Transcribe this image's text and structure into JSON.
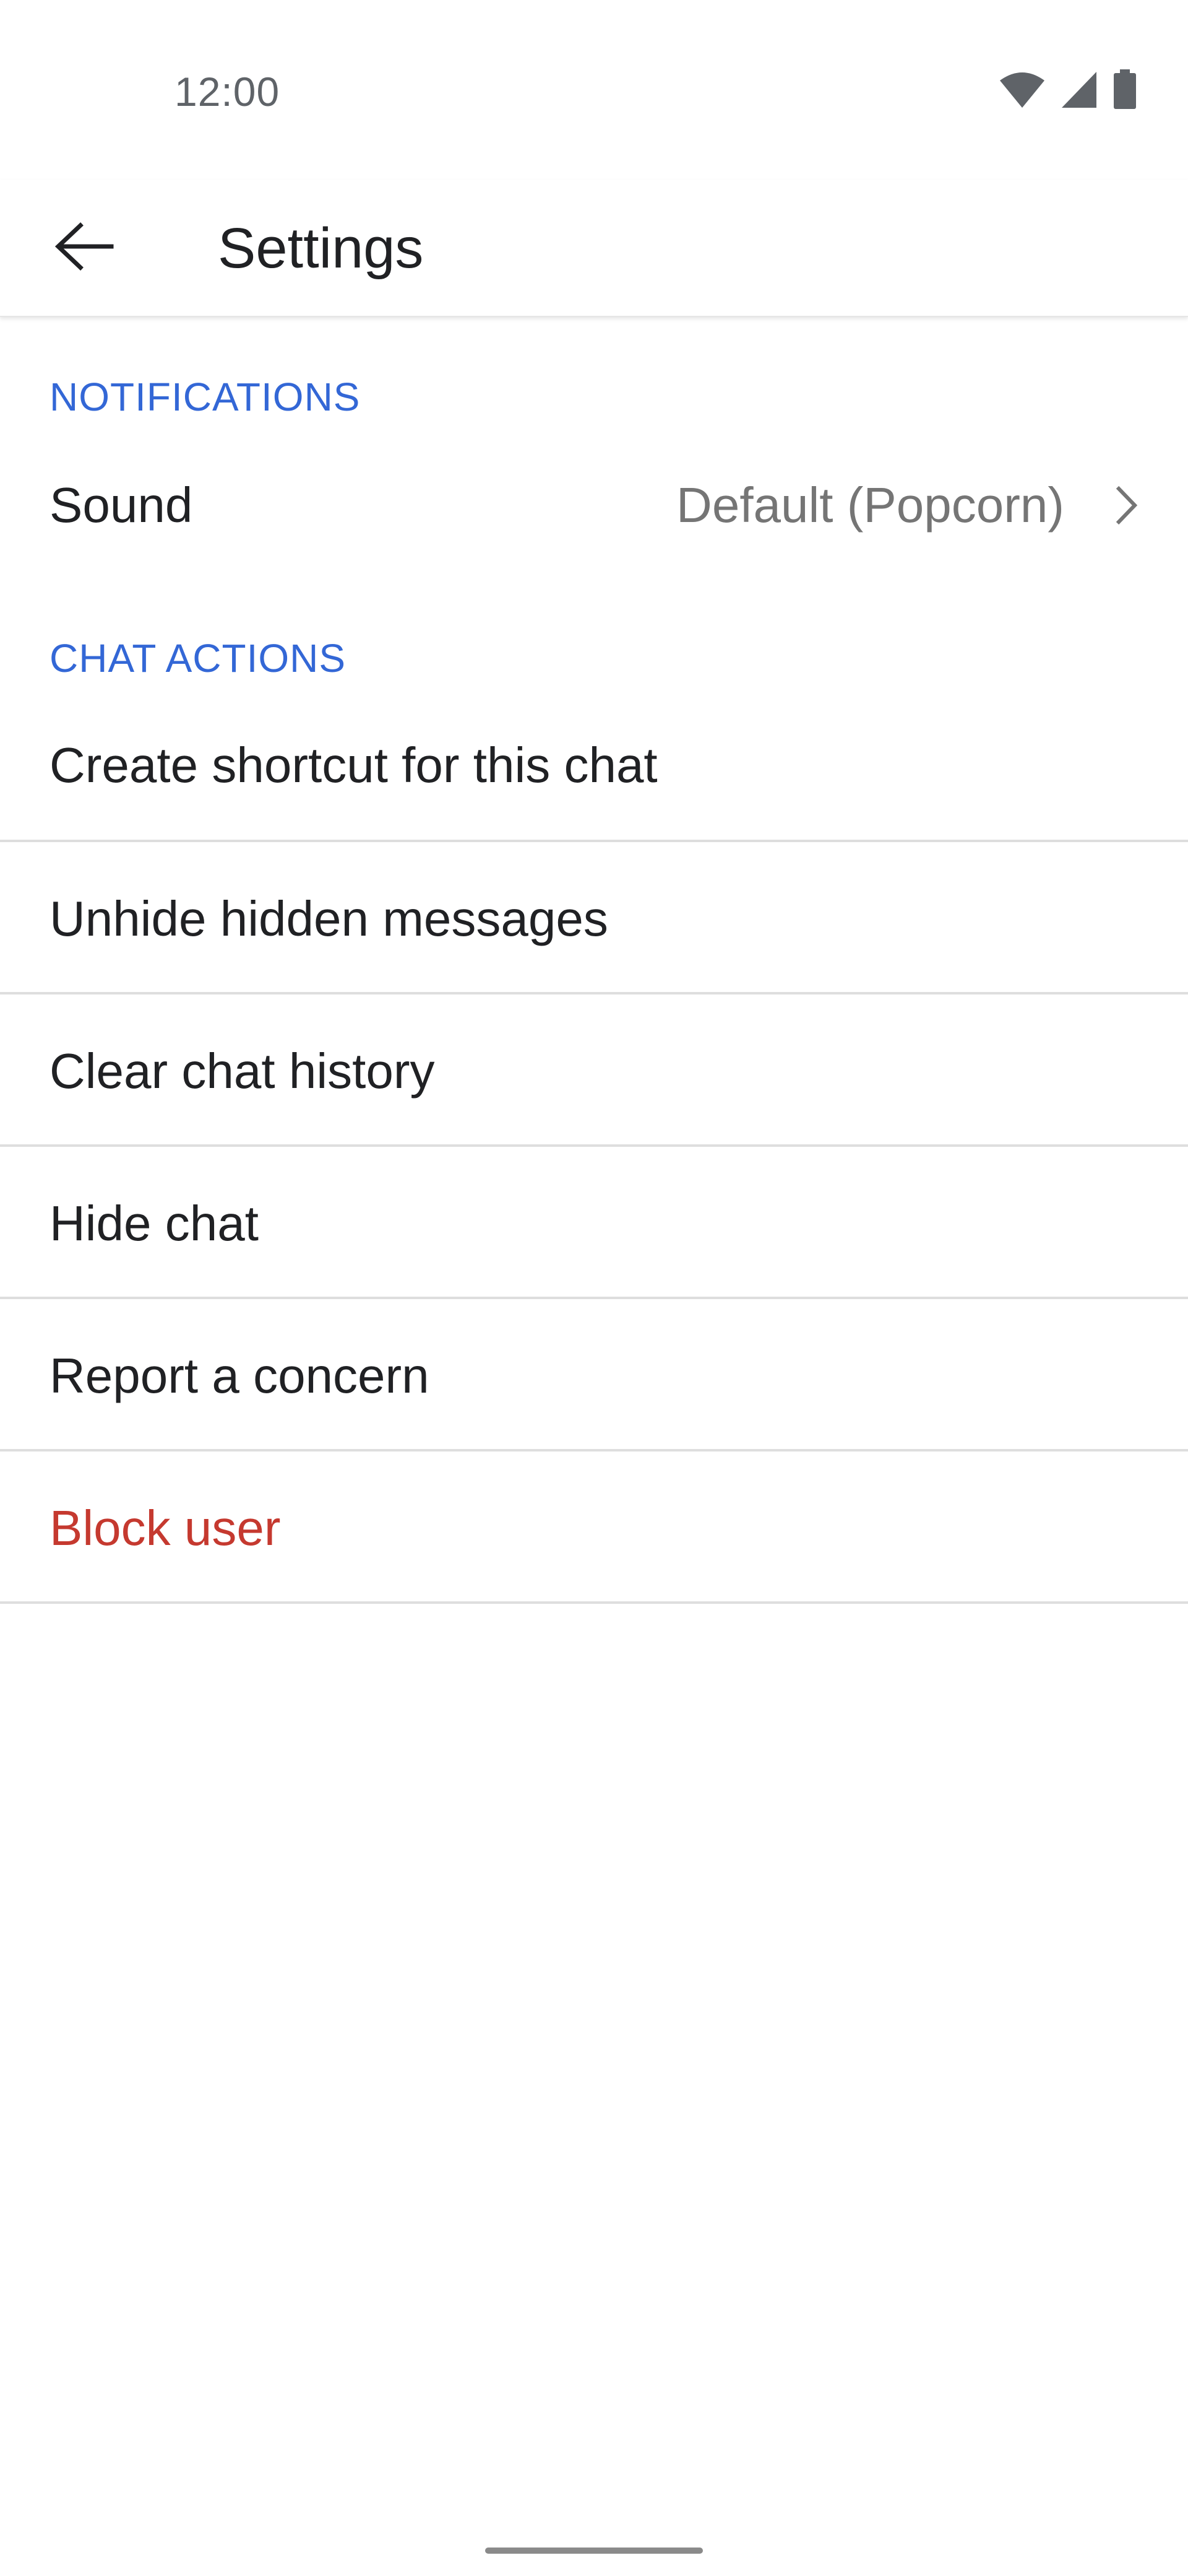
{
  "status_bar": {
    "time": "12:00",
    "icons": [
      "wifi-icon",
      "cellular-signal-icon",
      "battery-icon"
    ]
  },
  "app_bar": {
    "back_icon": "arrow-back-icon",
    "title": "Settings"
  },
  "sections": {
    "notifications": {
      "header": "NOTIFICATIONS",
      "sound": {
        "label": "Sound",
        "value": "Default (Popcorn)"
      }
    },
    "chat_actions": {
      "header": "CHAT ACTIONS",
      "items": [
        {
          "label": "Create shortcut for this chat"
        },
        {
          "label": "Unhide hidden messages"
        },
        {
          "label": "Clear chat history"
        },
        {
          "label": "Hide chat"
        },
        {
          "label": "Report a concern"
        },
        {
          "label": "Block user"
        }
      ]
    }
  },
  "colors": {
    "section_header": "#3367d6",
    "danger": "#c5392f",
    "primary_text": "#202124",
    "secondary_text": "#757575"
  }
}
